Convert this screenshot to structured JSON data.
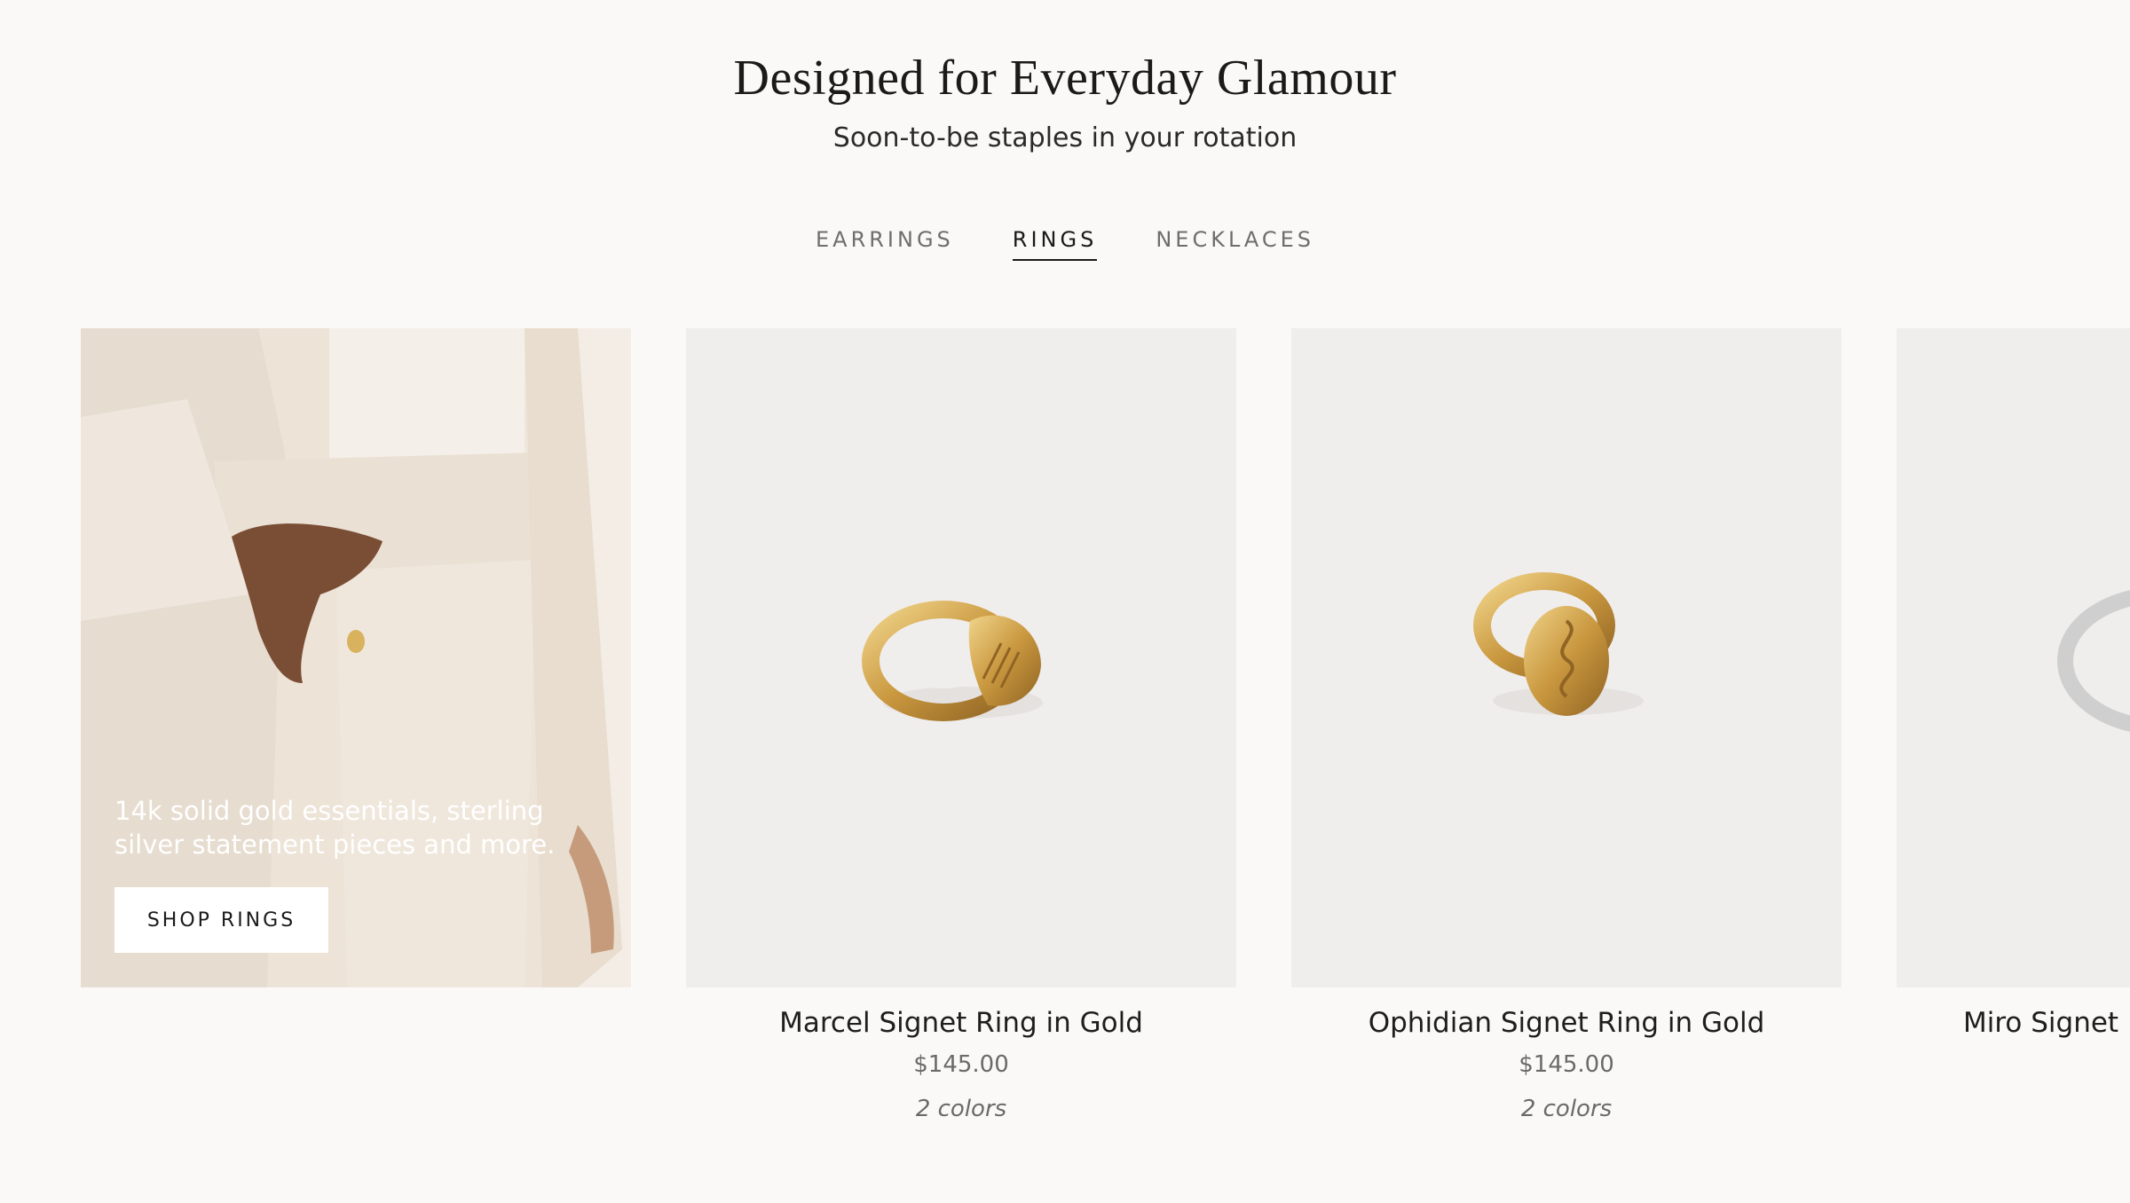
{
  "section": {
    "title": "Designed for Everyday Glamour",
    "subtitle": "Soon-to-be staples in your rotation"
  },
  "tabs": [
    {
      "label": "EARRINGS",
      "active": false
    },
    {
      "label": "RINGS",
      "active": true
    },
    {
      "label": "NECKLACES",
      "active": false
    }
  ],
  "promo": {
    "text": "14k solid gold essentials, sterling silver statement pieces and more.",
    "button_label": "SHOP RINGS"
  },
  "products": [
    {
      "name": "Marcel Signet Ring in Gold",
      "price": "$145.00",
      "colors": "2 colors",
      "image_icon": "gold-signet-ring-shell"
    },
    {
      "name": "Ophidian Signet Ring in Gold",
      "price": "$145.00",
      "colors": "2 colors",
      "image_icon": "gold-signet-ring-snake"
    },
    {
      "name": "Miro Signet R",
      "price": "",
      "colors": "",
      "image_icon": "silver-signet-ring"
    }
  ],
  "colors": {
    "background": "#fbf9f8",
    "product_bg": "#f0eeed",
    "gold": "#c9a04a",
    "text": "#1e1e1e"
  }
}
